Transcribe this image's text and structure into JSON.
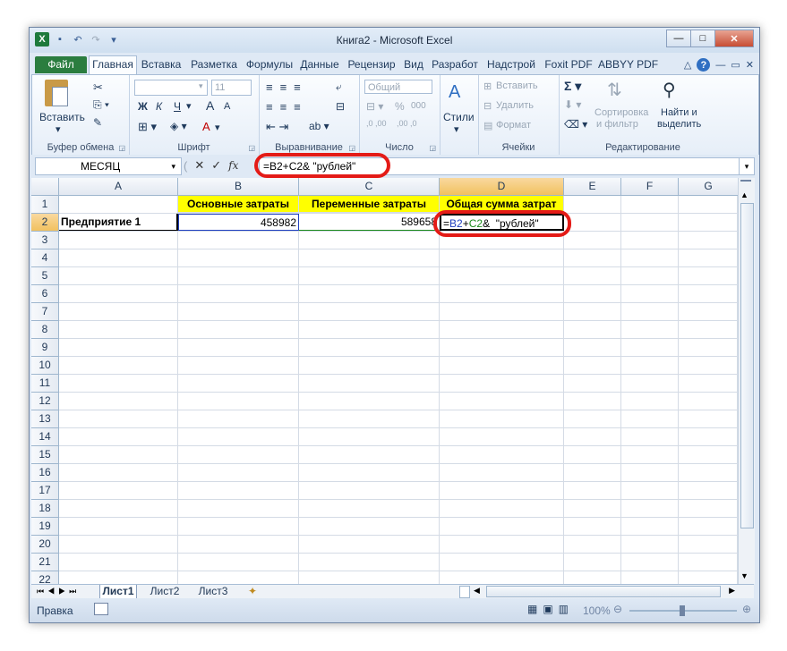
{
  "window": {
    "title": "Книга2 - Microsoft Excel"
  },
  "tabs": [
    "Файл",
    "Главная",
    "Вставка",
    "Разметка",
    "Формулы",
    "Данные",
    "Рецензир",
    "Вид",
    "Разработ",
    "Надстрой",
    "Foxit PDF",
    "ABBYY PDF"
  ],
  "ribbon": {
    "clipboard": {
      "paste": "Вставить",
      "label": "Буфер обмена"
    },
    "font": {
      "size": "11",
      "bold": "Ж",
      "italic": "К",
      "underline": "Ч",
      "grow": "A",
      "shrink": "A",
      "label": "Шрифт"
    },
    "alignment": {
      "label": "Выравнивание"
    },
    "number": {
      "format": "Общий",
      "percent": "%",
      "thousands": "000",
      "inc": ",0 ,00",
      "dec": ",00 ,0",
      "label": "Число"
    },
    "styles": {
      "button": "Стили"
    },
    "cells": {
      "insert": "Вставить",
      "delete": "Удалить",
      "format": "Формат",
      "label": "Ячейки"
    },
    "editing": {
      "sort": "Сортировка",
      "sort2": "и фильтр",
      "find": "Найти и",
      "find2": "выделить",
      "label": "Редактирование"
    }
  },
  "formula_bar": {
    "name_box": "МЕСЯЦ",
    "fx": "fx",
    "formula": "=B2+C2&  \"рублей\""
  },
  "columns": [
    "A",
    "B",
    "C",
    "D",
    "E",
    "F",
    "G"
  ],
  "rows": [
    "1",
    "2",
    "3",
    "4",
    "5",
    "6",
    "7",
    "8",
    "9",
    "10",
    "11",
    "12",
    "13",
    "14",
    "15",
    "16",
    "17",
    "18",
    "19",
    "20",
    "21",
    "22"
  ],
  "cells": {
    "b1": "Основные затраты",
    "c1": "Переменные затраты",
    "d1": "Общая сумма затрат",
    "a2": "Предприятие 1",
    "b2": "458982",
    "c2": "589658",
    "d2_eq": "=",
    "d2_b2": "B2",
    "d2_plus": "+",
    "d2_c2": "C2",
    "d2_rest": "&  \"рублей\""
  },
  "sheets": [
    "Лист1",
    "Лист2",
    "Лист3"
  ],
  "status": {
    "mode": "Правка",
    "zoom": "100%"
  },
  "colors": {
    "highlight": "#ffff00",
    "annotation": "#e41b17",
    "ref_b2": "#1f3fbf",
    "ref_c2": "#1a8a1a"
  }
}
